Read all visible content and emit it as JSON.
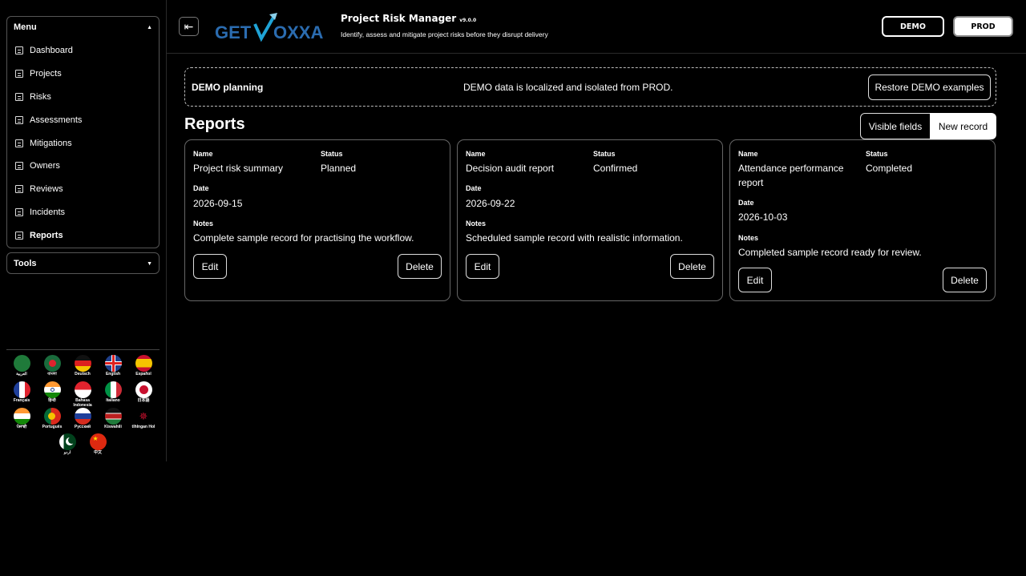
{
  "sidebar": {
    "menu_title": "Menu",
    "menu_items": [
      {
        "label": "Dashboard"
      },
      {
        "label": "Projects"
      },
      {
        "label": "Risks"
      },
      {
        "label": "Assessments"
      },
      {
        "label": "Mitigations"
      },
      {
        "label": "Owners"
      },
      {
        "label": "Reviews"
      },
      {
        "label": "Incidents"
      },
      {
        "label": "Reports"
      }
    ],
    "active_item": "Reports",
    "tools_title": "Tools",
    "languages": [
      {
        "label": "العربية"
      },
      {
        "label": "বাংলা"
      },
      {
        "label": "Deutsch"
      },
      {
        "label": "English"
      },
      {
        "label": "Español"
      },
      {
        "label": "Français"
      },
      {
        "label": "हिन्दी"
      },
      {
        "label": "Bahasa Indonesia"
      },
      {
        "label": "Italiano"
      },
      {
        "label": "日本語"
      },
      {
        "label": "ਪੰਜਾਬੀ"
      },
      {
        "label": "Português"
      },
      {
        "label": "Русский"
      },
      {
        "label": "Kiswahili"
      },
      {
        "label": "tlhIngan Hol"
      },
      {
        "label": "اردو"
      },
      {
        "label": "中文"
      }
    ]
  },
  "header": {
    "logo_text_left": "GET",
    "logo_text_right": "OXXA",
    "app_title": "Project Risk Manager",
    "version": "v9.0.0",
    "subtitle": "Identify, assess and mitigate project risks before they disrupt delivery",
    "env_demo": "DEMO",
    "env_prod": "PROD"
  },
  "banner": {
    "title": "DEMO planning",
    "text": "DEMO data is localized and isolated from PROD.",
    "restore_label": "Restore DEMO examples"
  },
  "main": {
    "title": "Reports",
    "visible_fields_label": "Visible fields",
    "new_record_label": "New record",
    "field_labels": {
      "name": "Name",
      "status": "Status",
      "date": "Date",
      "notes": "Notes"
    },
    "edit_label": "Edit",
    "delete_label": "Delete",
    "records": [
      {
        "name": "Project risk summary",
        "status": "Planned",
        "date": "2026-09-15",
        "notes": "Complete sample record for practising the workflow."
      },
      {
        "name": "Decision audit report",
        "status": "Confirmed",
        "date": "2026-09-22",
        "notes": "Scheduled sample record with realistic information."
      },
      {
        "name": "Attendance performance report",
        "status": "Completed",
        "date": "2026-10-03",
        "notes": "Completed sample record ready for review."
      }
    ]
  },
  "colors": {
    "background": "#000000",
    "text": "#ffffff",
    "logo_blue": "#2b6cb0",
    "logo_accent": "#1fa3d6"
  }
}
